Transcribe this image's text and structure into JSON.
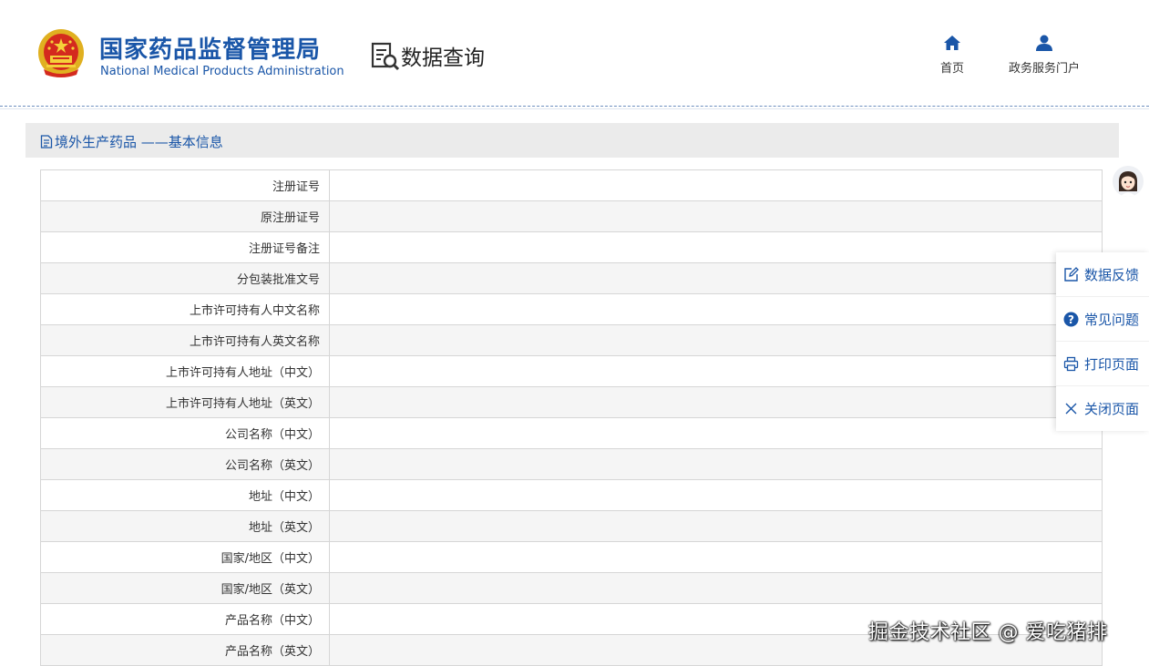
{
  "header": {
    "brand_cn": "国家药品监督管理局",
    "brand_en": "National Medical Products Administration",
    "section_title": "数据查询",
    "nav": [
      {
        "label": "首页",
        "icon": "home-icon"
      },
      {
        "label": "政务服务门户",
        "icon": "user-icon"
      }
    ]
  },
  "panel": {
    "title": "境外生产药品 ——基本信息",
    "rows": [
      {
        "label": "注册证号",
        "value": ""
      },
      {
        "label": "原注册证号",
        "value": ""
      },
      {
        "label": "注册证号备注",
        "value": ""
      },
      {
        "label": "分包装批准文号",
        "value": ""
      },
      {
        "label": "上市许可持有人中文名称",
        "value": ""
      },
      {
        "label": "上市许可持有人英文名称",
        "value": ""
      },
      {
        "label": "上市许可持有人地址（中文）",
        "value": ""
      },
      {
        "label": "上市许可持有人地址（英文）",
        "value": ""
      },
      {
        "label": "公司名称（中文）",
        "value": ""
      },
      {
        "label": "公司名称（英文）",
        "value": ""
      },
      {
        "label": "地址（中文）",
        "value": ""
      },
      {
        "label": "地址（英文）",
        "value": ""
      },
      {
        "label": "国家/地区（中文）",
        "value": ""
      },
      {
        "label": "国家/地区（英文）",
        "value": ""
      },
      {
        "label": "产品名称（中文）",
        "value": ""
      },
      {
        "label": "产品名称（英文）",
        "value": ""
      }
    ]
  },
  "sidebar": {
    "items": [
      {
        "label": "数据反馈",
        "icon": "edit-icon"
      },
      {
        "label": "常见问题",
        "icon": "question-icon"
      },
      {
        "label": "打印页面",
        "icon": "print-icon"
      },
      {
        "label": "关闭页面",
        "icon": "close-icon"
      }
    ]
  },
  "watermark": "掘金技术社区 @ 爱吃猪排",
  "colors": {
    "brand": "#1a56a8",
    "panel_head": "#ebebeb",
    "row_alt": "#f5f5f5",
    "border": "#d6d6d6"
  }
}
